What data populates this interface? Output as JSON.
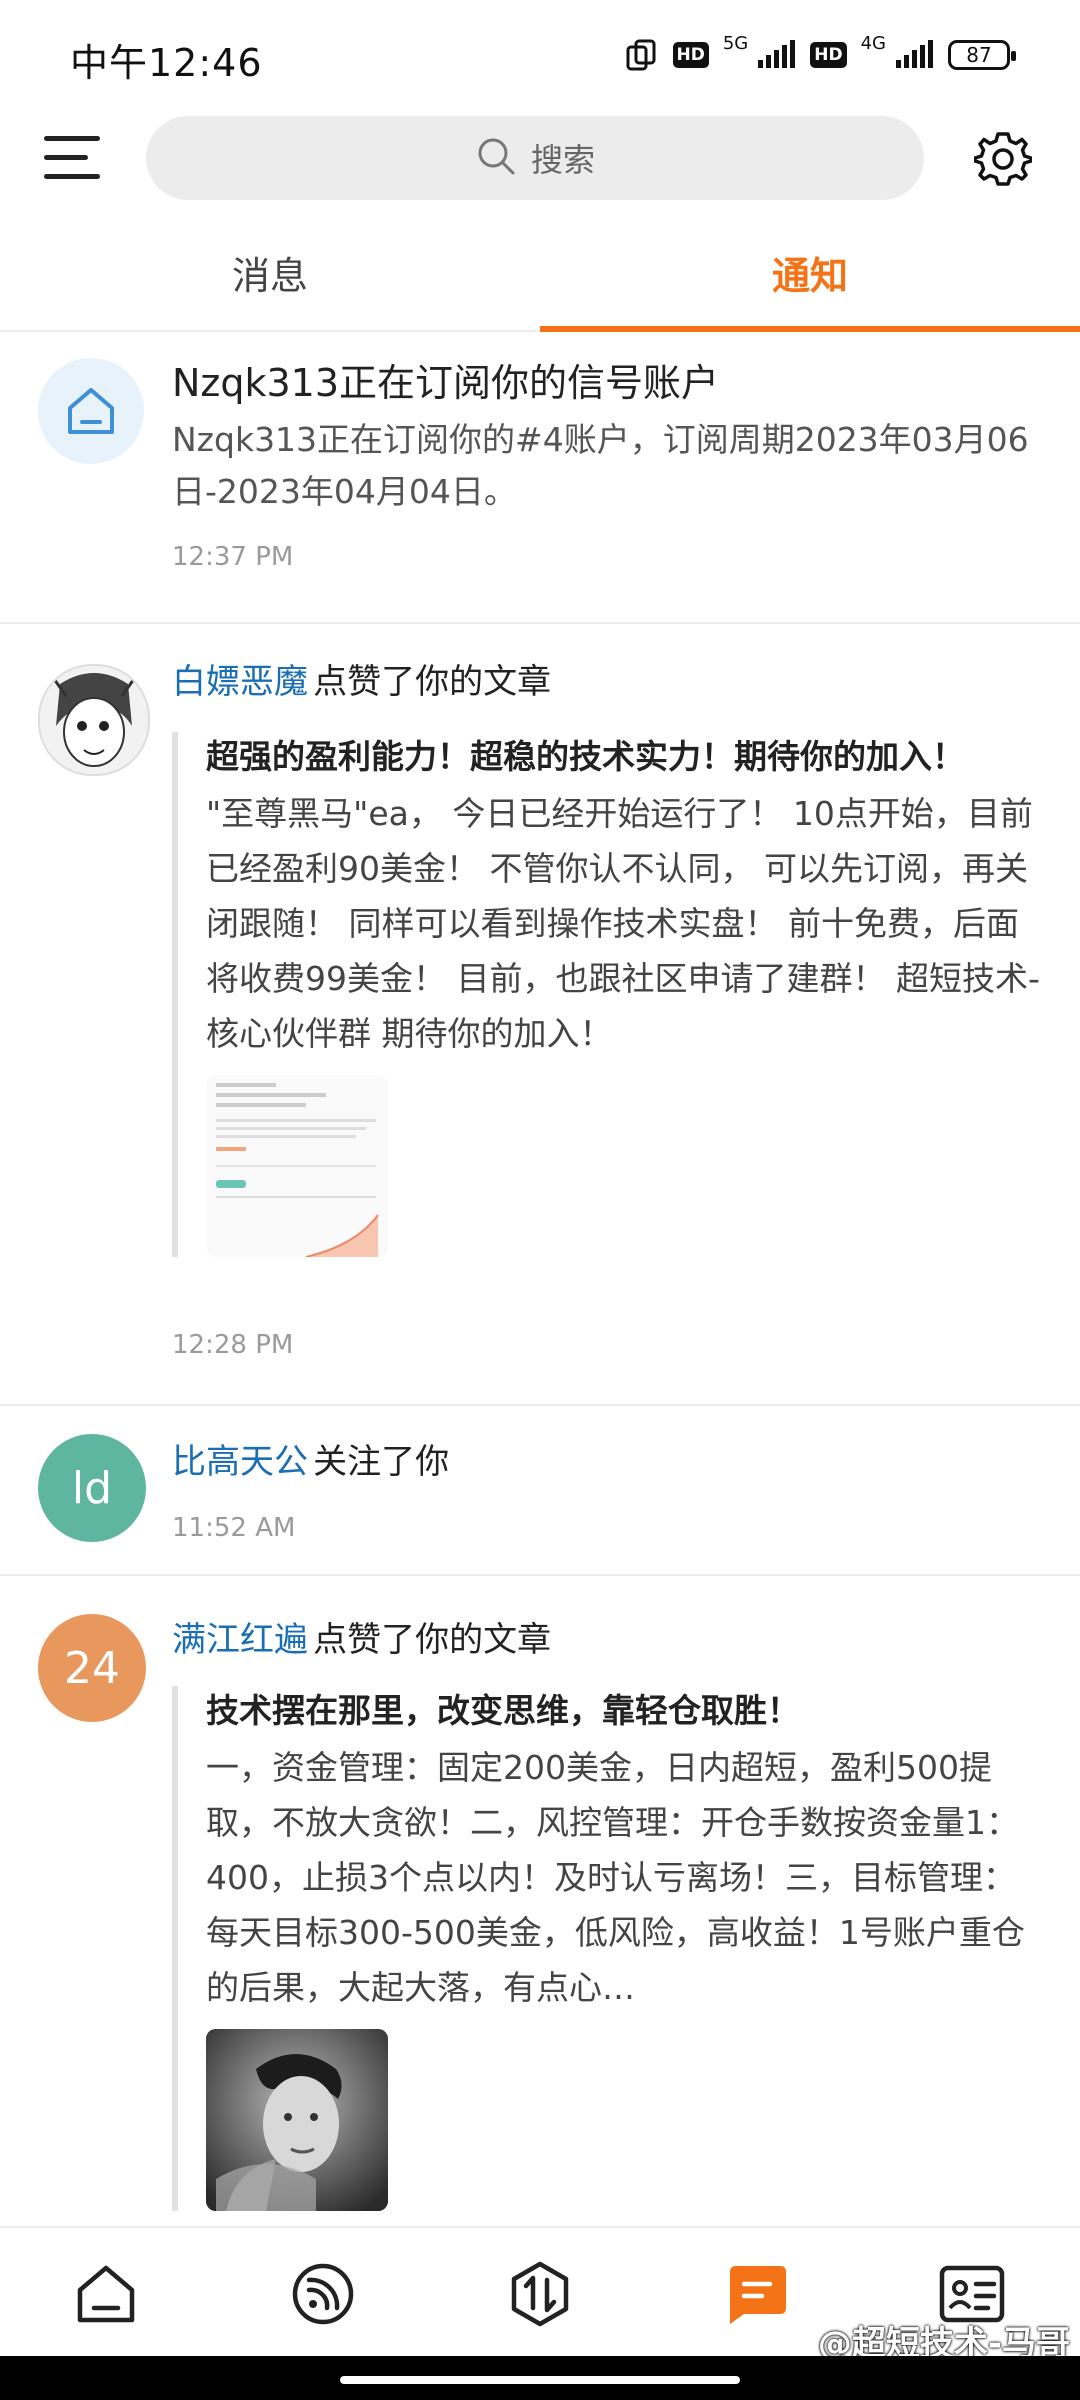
{
  "status_bar": {
    "time": "中午12:46",
    "hd1": "HD",
    "net1": "5G",
    "hd2": "HD",
    "net2": "4G",
    "battery": "87"
  },
  "header": {
    "search_placeholder": "搜索"
  },
  "tabs": [
    {
      "label": "消息",
      "active": false
    },
    {
      "label": "通知",
      "active": true
    }
  ],
  "feed": [
    {
      "type": "system",
      "title": "Nzqk313正在订阅你的信号账户",
      "text": "Nzqk313正在订阅你的#4账户，订阅周期2023年03月06日-2023年04月04日。",
      "time": "12:37 PM"
    },
    {
      "type": "like",
      "actor": "白嫖恶魔",
      "action": "点赞了你的文章",
      "article_title": "超强的盈利能力！超稳的技术实力！期待你的加入！",
      "article_body": "\"至尊黑马\"ea， 今日已经开始运行了！ 10点开始，目前已经盈利90美金！ 不管你认不认同， 可以先订阅，再关闭跟随！ 同样可以看到操作技术实盘！ 前十免费，后面将收费99美金！ 目前，也跟社区申请了建群！ 超短技术-核心伙伴群 期待你的加入！",
      "time": "12:28 PM"
    },
    {
      "type": "follow",
      "avatar_text": "ld",
      "actor": "比高天公",
      "action": "关注了你",
      "time": "11:52 AM"
    },
    {
      "type": "like",
      "avatar_text": "24",
      "actor": "满江红遍",
      "action": "点赞了你的文章",
      "article_title": "技术摆在那里，改变思维，靠轻仓取胜！",
      "article_body": "一，资金管理：固定200美金，日内超短，盈利500提取，不放大贪欲！二，风控管理：开仓手数按资金量1：400，止损3个点以内！及时认亏离场！三，目标管理：每天目标300-500美金，低风险，高收益！1号账户重仓的后果，大起大落，有点心…"
    }
  ],
  "bottom_nav": {
    "items": [
      "home-icon",
      "feed-icon",
      "exchange-icon",
      "message-icon",
      "profile-card-icon"
    ],
    "watermark": "@超短技术-马哥"
  },
  "colors": {
    "accent": "#f47316",
    "link": "#1a6fb4",
    "avatar_green": "#5fb6a0",
    "avatar_orange": "#e8975d"
  }
}
